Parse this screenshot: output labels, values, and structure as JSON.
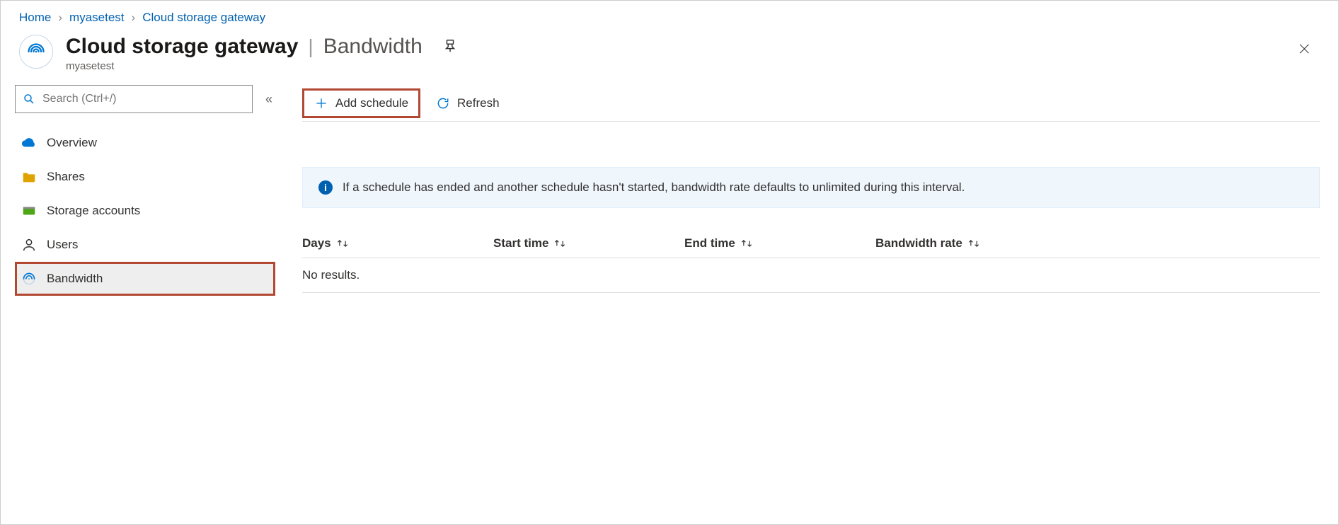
{
  "breadcrumb": {
    "home": "Home",
    "resource": "myasetest",
    "section": "Cloud storage gateway"
  },
  "header": {
    "title": "Cloud storage gateway",
    "page": "Bandwidth",
    "subtitle": "myasetest"
  },
  "sidebar": {
    "search_placeholder": "Search (Ctrl+/)",
    "items": [
      {
        "label": "Overview"
      },
      {
        "label": "Shares"
      },
      {
        "label": "Storage accounts"
      },
      {
        "label": "Users"
      },
      {
        "label": "Bandwidth"
      }
    ]
  },
  "toolbar": {
    "add_schedule": "Add schedule",
    "refresh": "Refresh"
  },
  "info": {
    "message": "If a schedule has ended and another schedule hasn't started, bandwidth rate defaults to unlimited during this interval."
  },
  "table": {
    "columns": {
      "days": "Days",
      "start": "Start time",
      "end": "End time",
      "rate": "Bandwidth rate"
    },
    "empty": "No results."
  }
}
